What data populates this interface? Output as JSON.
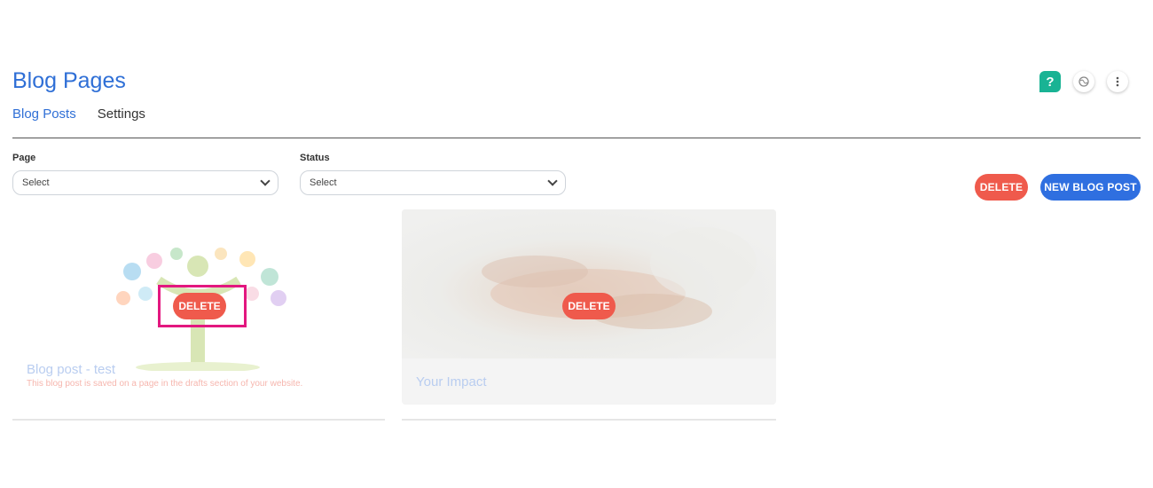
{
  "header": {
    "title": "Blog Pages",
    "tabs": [
      {
        "label": "Blog Posts",
        "active": true
      },
      {
        "label": "Settings",
        "active": false
      }
    ],
    "icons": [
      "help-icon",
      "globe-icon",
      "more-vertical-icon"
    ]
  },
  "filters": {
    "page": {
      "label": "Page",
      "value": "Select"
    },
    "status": {
      "label": "Status",
      "value": "Select"
    }
  },
  "actions": {
    "delete_label": "DELETE",
    "new_post_label": "NEW BLOG POST"
  },
  "posts": [
    {
      "title": "Blog post - test",
      "subtitle": "This blog post is saved on a page in the drafts section of your website.",
      "delete_label": "DELETE"
    },
    {
      "title": "Your Impact",
      "delete_label": "DELETE"
    }
  ],
  "colors": {
    "accent": "#2f6fd6",
    "danger": "#ef5a4c",
    "help": "#19b394",
    "highlight": "#e3177f"
  }
}
